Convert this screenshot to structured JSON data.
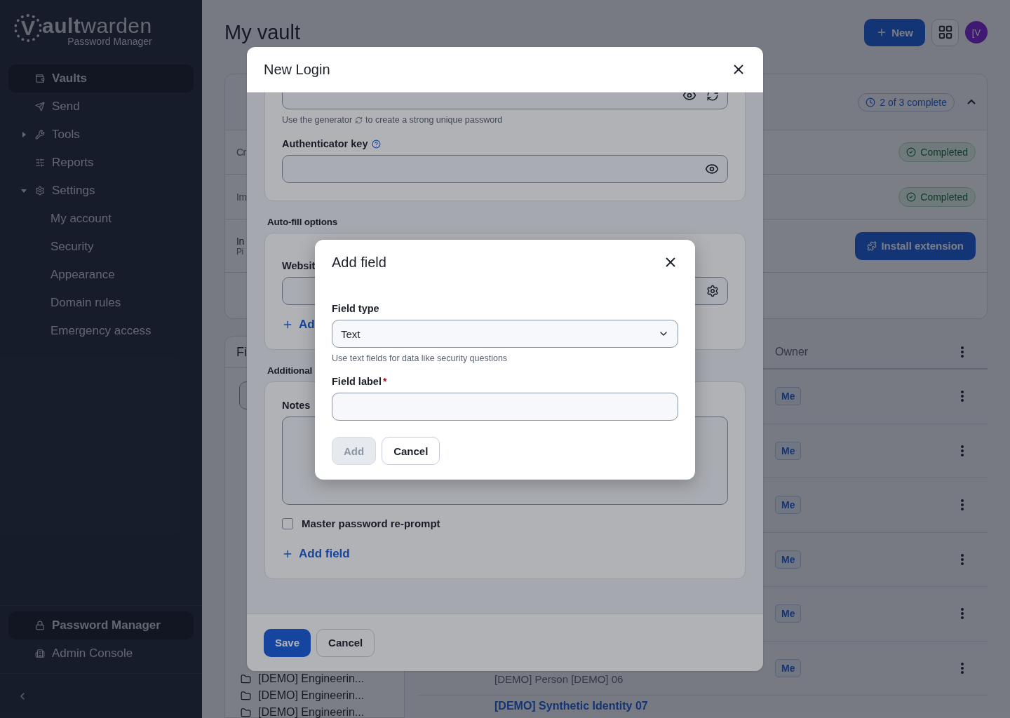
{
  "sidebar": {
    "logo": {
      "mark": "V",
      "word": "**ault**warden",
      "subtitle": "Password Manager"
    },
    "nav": [
      {
        "label": "Vaults",
        "selected": true
      },
      {
        "label": "Send",
        "selected": false
      },
      {
        "label": "Tools",
        "selected": false,
        "expanded": false
      },
      {
        "label": "Reports",
        "selected": false
      },
      {
        "label": "Settings",
        "selected": false,
        "expanded": true,
        "children": [
          {
            "label": "My account",
            "selected": false
          },
          {
            "label": "Security",
            "selected": false
          },
          {
            "label": "Appearance",
            "selected": false
          },
          {
            "label": "Domain rules",
            "selected": false
          },
          {
            "label": "Emergency access",
            "selected": false
          }
        ]
      }
    ],
    "products": [
      {
        "label": "Password Manager",
        "selected": true
      },
      {
        "label": "Admin Console",
        "selected": false
      }
    ]
  },
  "main": {
    "title": "My vault",
    "new_button": "New",
    "avatar": "[V",
    "onboarding": {
      "progress": "2 of 3 complete",
      "expanded": true,
      "rows": [
        {
          "kind": "status",
          "label": "Cr",
          "status": "Completed"
        },
        {
          "kind": "status",
          "label": "Im",
          "status": "Completed"
        },
        {
          "kind": "action",
          "label": "In",
          "sublabel": "Pi",
          "action": "Install extension"
        }
      ]
    },
    "filters": {
      "title": "Fi",
      "folders": [
        "[DEMO] Engineerin...",
        "[DEMO] Engineerin...",
        "[DEMO] Engineerin..."
      ]
    },
    "table": {
      "columns": [
        {
          "label": "Owner"
        }
      ],
      "rows": [
        {
          "owner": "Me"
        },
        {
          "owner": "Me"
        },
        {
          "owner": "Me"
        },
        {
          "owner": "Me"
        },
        {
          "owner": "Me"
        },
        {
          "subtitle": "[DEMO] Person [DEMO] 06",
          "owner": "Me"
        },
        {
          "title": "[DEMO] Synthetic Identity 07"
        }
      ]
    }
  },
  "new_login": {
    "title": "New Login",
    "generator_hint": [
      "Use the generator",
      "to create a strong unique password"
    ],
    "authenticator_label": "Authenticator key",
    "autofill_heading": "Auto-fill options",
    "website_label": "Websit",
    "add_website": "Ad",
    "additional_heading": "Additional",
    "notes_label": "Notes",
    "reprompt": {
      "label": "Master password re-prompt",
      "checked": false
    },
    "add_field": "Add field",
    "save": "Save",
    "cancel": "Cancel"
  },
  "add_field_dialog": {
    "title": "Add field",
    "field_type_label": "Field type",
    "field_type_value": "Text",
    "field_type_hint": "Use text fields for data like security questions",
    "field_label": "Field label",
    "required": "*",
    "add": {
      "label": "Add",
      "disabled": true
    },
    "cancel": "Cancel"
  }
}
